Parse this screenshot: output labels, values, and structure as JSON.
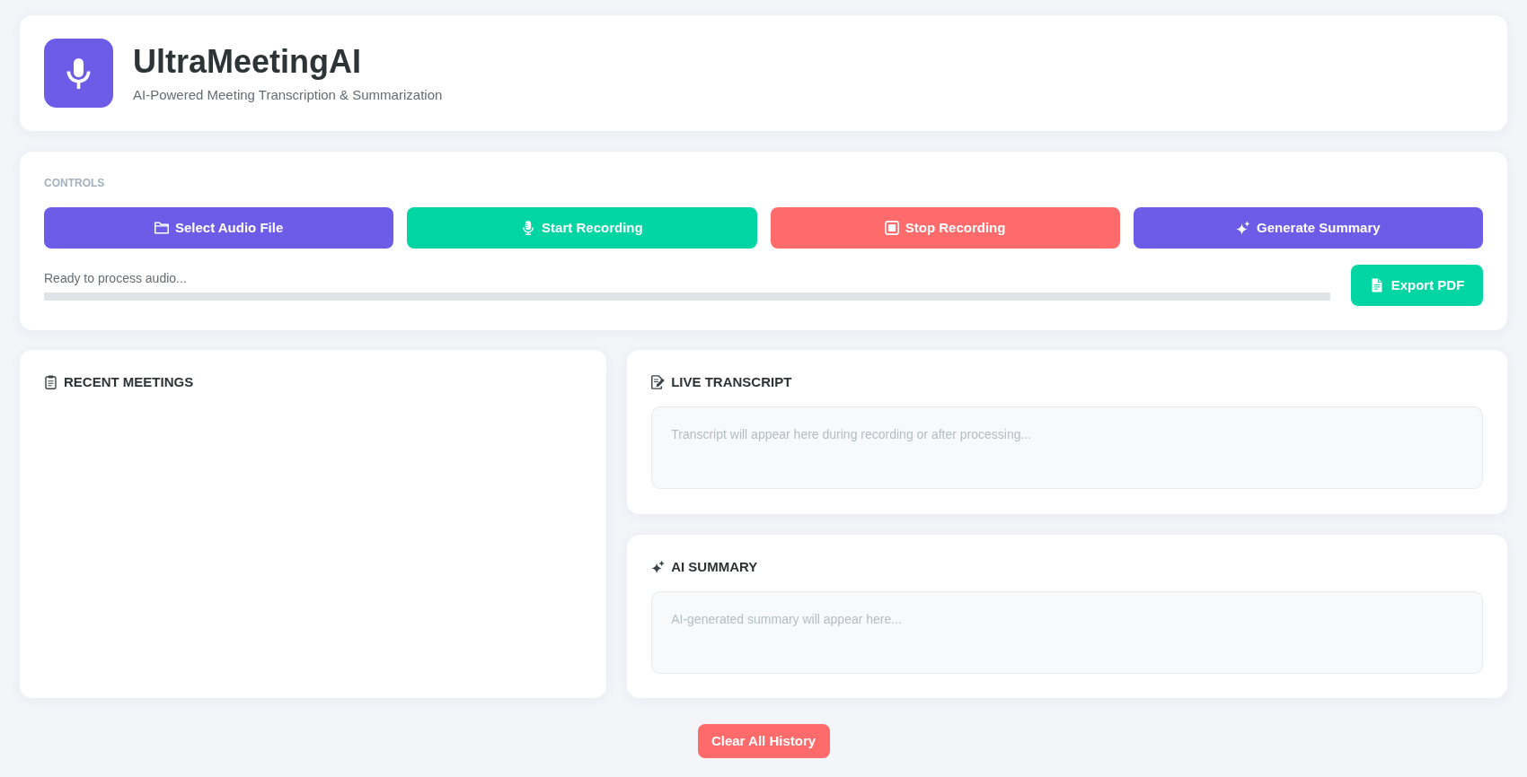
{
  "header": {
    "title": "UltraMeetingAI",
    "subtitle": "AI-Powered Meeting Transcription & Summarization"
  },
  "controls": {
    "label": "CONTROLS",
    "buttons": [
      {
        "label": "Select Audio File",
        "color": "#6c5ce7"
      },
      {
        "label": "Start Recording",
        "color": "#00d5a3"
      },
      {
        "label": "Stop Recording",
        "color": "#ff6b6b"
      },
      {
        "label": "Generate Summary",
        "color": "#6c5ce7"
      }
    ],
    "status": "Ready to process audio...",
    "progress": {
      "level": 0
    },
    "export_button": {
      "label": "Export PDF"
    }
  },
  "recent_meetings": {
    "title": "RECENT MEETINGS"
  },
  "live_transcript": {
    "title": "LIVE TRANSCRIPT",
    "empty_text": "Transcript will appear here during recording or after processing..."
  },
  "ai_summary": {
    "title": "AI SUMMARY",
    "empty_text": "AI-generated summary will appear here..."
  },
  "clear_button": {
    "label": "Clear All History"
  }
}
